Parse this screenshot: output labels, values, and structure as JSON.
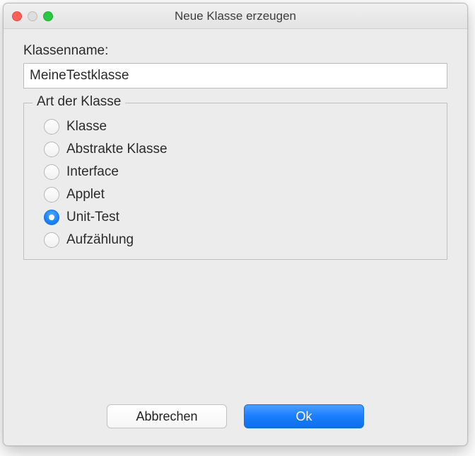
{
  "window": {
    "title": "Neue Klasse erzeugen"
  },
  "form": {
    "classname_label": "Klassenname:",
    "classname_value": "MeineTestklasse"
  },
  "fieldset": {
    "legend": "Art der Klasse",
    "options": [
      {
        "label": "Klasse",
        "selected": false
      },
      {
        "label": "Abstrakte Klasse",
        "selected": false
      },
      {
        "label": "Interface",
        "selected": false
      },
      {
        "label": "Applet",
        "selected": false
      },
      {
        "label": "Unit-Test",
        "selected": true
      },
      {
        "label": "Aufzählung",
        "selected": false
      }
    ]
  },
  "buttons": {
    "cancel": "Abbrechen",
    "ok": "Ok"
  }
}
